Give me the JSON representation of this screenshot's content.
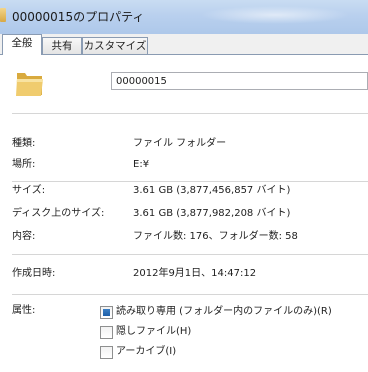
{
  "window": {
    "title": "00000015のプロパティ"
  },
  "tabs": [
    {
      "label": "全般",
      "active": true
    },
    {
      "label": "共有",
      "active": false
    },
    {
      "label": "カスタマイズ",
      "active": false
    }
  ],
  "general": {
    "name_value": "00000015",
    "rows": {
      "type": {
        "label": "種類:",
        "value": "ファイル フォルダー"
      },
      "location": {
        "label": "場所:",
        "value": "E:¥"
      },
      "size": {
        "label": "サイズ:",
        "value": "3.61 GB (3,877,456,857 バイト)"
      },
      "size_on_disk": {
        "label": "ディスク上のサイズ:",
        "value": "3.61 GB (3,877,982,208 バイト)"
      },
      "contents": {
        "label": "内容:",
        "value": "ファイル数: 176、フォルダー数: 58"
      },
      "created": {
        "label": "作成日時:",
        "value": "2012年9月1日、14:47:12"
      }
    },
    "attributes": {
      "label": "属性:",
      "readonly": {
        "label": "読み取り専用 (フォルダー内のファイルのみ)(R)",
        "checked": true
      },
      "hidden": {
        "label": "隠しファイル(H)",
        "checked": false
      },
      "archive": {
        "label": "アーカイブ(I)",
        "checked": false
      }
    }
  },
  "colors": {
    "title_bar": "#b9d0ee",
    "tab_border": "#8a9bb2",
    "checkbox_fill": "#1d5fa8",
    "folder": "#e7c05f"
  },
  "icons": {
    "title": "folder-icon",
    "general": "folder-icon"
  }
}
